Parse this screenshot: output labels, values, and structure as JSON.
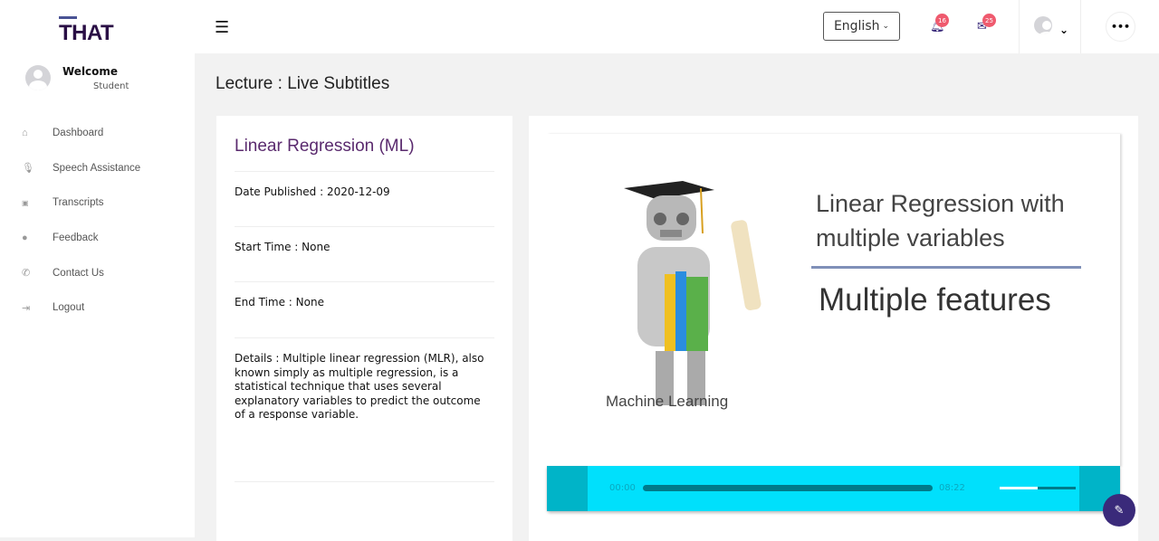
{
  "brand": {
    "logo": "THAT"
  },
  "user": {
    "greeting": "Welcome",
    "role": "Student"
  },
  "sidebar": {
    "items": [
      {
        "label": "Dashboard",
        "icon": "home-icon"
      },
      {
        "label": "Speech Assistance",
        "icon": "microphone-icon"
      },
      {
        "label": "Transcripts",
        "icon": "closed-captions-icon"
      },
      {
        "label": "Feedback",
        "icon": "comment-icon"
      },
      {
        "label": "Contact Us",
        "icon": "phone-icon"
      },
      {
        "label": "Logout",
        "icon": "logout-icon"
      }
    ]
  },
  "topbar": {
    "language": "English",
    "notifications": "16",
    "messages": "25"
  },
  "page": {
    "title": "Lecture : Live Subtitles"
  },
  "lecture": {
    "name": "Linear Regression (ML)",
    "date": "Date Published : 2020-12-09",
    "start": "Start Time : None",
    "end": "End Time : None",
    "details": "Details : Multiple linear regression (MLR), also known simply as multiple regression, is a statistical technique that uses several explanatory variables to predict the outcome of a response variable."
  },
  "slide": {
    "heading": "Linear Regression with multiple variables",
    "subheading": "Multiple features",
    "caption": "Machine Learning"
  },
  "player": {
    "current": "00:00",
    "duration": "08:22",
    "progress": 0,
    "volume": 0.5,
    "color": "#00e0fc"
  }
}
